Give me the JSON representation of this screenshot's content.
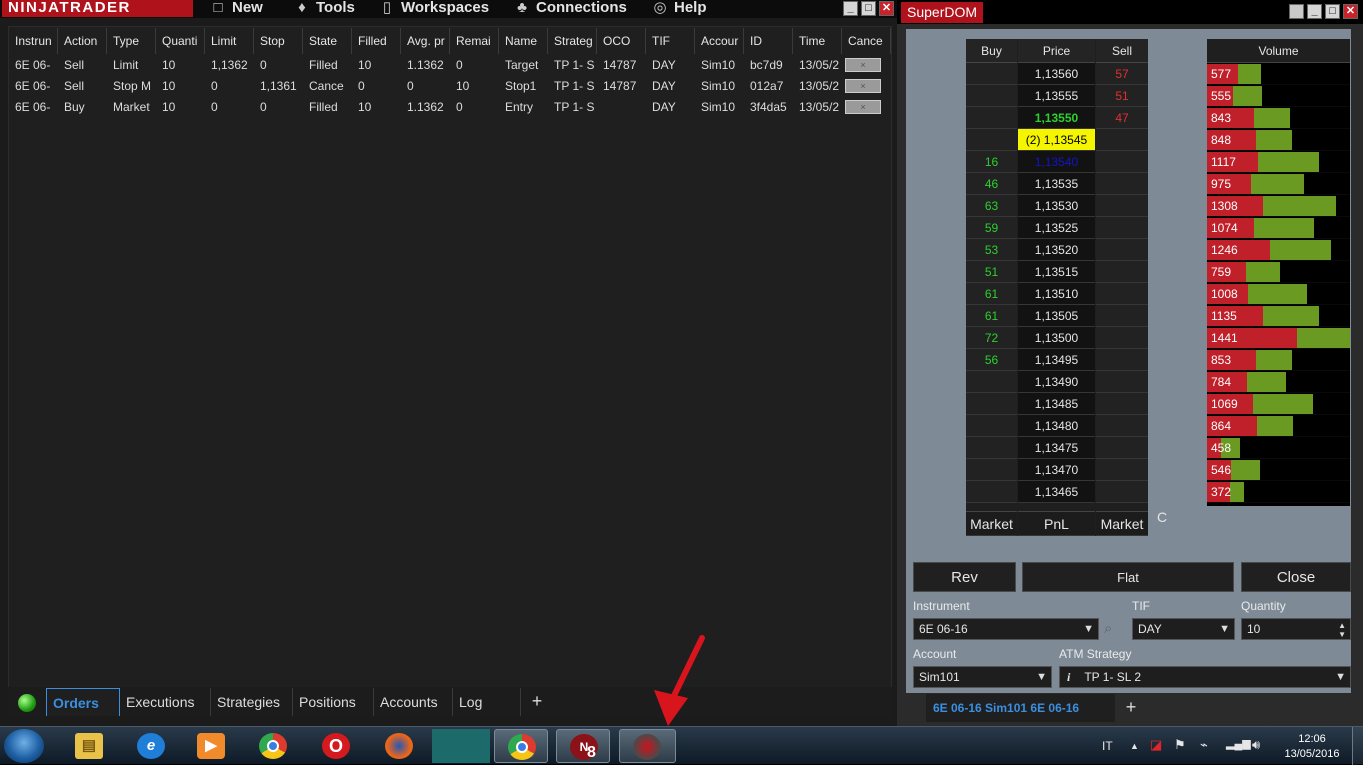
{
  "main": {
    "logo": "NINJATRADER",
    "menu": [
      {
        "icon": "new-window-icon",
        "glyph": "□",
        "label": "New"
      },
      {
        "icon": "wrench-icon",
        "glyph": "♦",
        "label": "Tools"
      },
      {
        "icon": "document-icon",
        "glyph": "▯",
        "label": "Workspaces"
      },
      {
        "icon": "plug-icon",
        "glyph": "♣",
        "label": "Connections"
      },
      {
        "icon": "lifebuoy-icon",
        "glyph": "◎",
        "label": "Help"
      }
    ]
  },
  "orders": {
    "columns": [
      "Instrun",
      "Action",
      "Type",
      "Quanti",
      "Limit",
      "Stop",
      "State",
      "Filled",
      "Avg. pr",
      "Remai",
      "Name",
      "Strateg",
      "OCO",
      "TIF",
      "Accour",
      "ID",
      "Time",
      "Cance"
    ],
    "rows": [
      [
        "6E 06-",
        "Sell",
        "Limit",
        "10",
        "1,1362",
        "0",
        "Filled",
        "10",
        "1.1362",
        "0",
        "Target",
        "TP 1- S",
        "14787",
        "DAY",
        "Sim10",
        "bc7d9",
        "13/05/2",
        "×"
      ],
      [
        "6E 06-",
        "Sell",
        "Stop M",
        "10",
        "0",
        "1,1361",
        "Cance",
        "0",
        "0",
        "10",
        "Stop1",
        "TP 1- S",
        "14787",
        "DAY",
        "Sim10",
        "012a7",
        "13/05/2",
        "×"
      ],
      [
        "6E 06-",
        "Buy",
        "Market",
        "10",
        "0",
        "0",
        "Filled",
        "10",
        "1.1362",
        "0",
        "Entry",
        "TP 1- S",
        "",
        "DAY",
        "Sim10",
        "3f4da5",
        "13/05/2",
        "×"
      ]
    ]
  },
  "bottom_tabs": [
    "Orders",
    "Executions",
    "Strategies",
    "Positions",
    "Accounts",
    "Log"
  ],
  "add_tab": "+",
  "superdom": {
    "title": "SuperDOM",
    "headers": {
      "buy": "Buy",
      "price": "Price",
      "sell": "Sell",
      "volume": "Volume"
    },
    "ladder": [
      {
        "buy": "",
        "price": "1,13560",
        "sell": "57"
      },
      {
        "buy": "",
        "price": "1,13555",
        "sell": "51"
      },
      {
        "buy": "",
        "price": "1,13550",
        "sell": "47",
        "style": "best-ask"
      },
      {
        "buy": "",
        "price": "(2) 1,13545",
        "sell": "",
        "style": "last"
      },
      {
        "buy": "16",
        "price": "1,13540",
        "sell": "",
        "style": "best-bid"
      },
      {
        "buy": "46",
        "price": "1,13535",
        "sell": ""
      },
      {
        "buy": "63",
        "price": "1,13530",
        "sell": ""
      },
      {
        "buy": "59",
        "price": "1,13525",
        "sell": ""
      },
      {
        "buy": "53",
        "price": "1,13520",
        "sell": ""
      },
      {
        "buy": "51",
        "price": "1,13515",
        "sell": ""
      },
      {
        "buy": "61",
        "price": "1,13510",
        "sell": ""
      },
      {
        "buy": "61",
        "price": "1,13505",
        "sell": ""
      },
      {
        "buy": "72",
        "price": "1,13500",
        "sell": ""
      },
      {
        "buy": "56",
        "price": "1,13495",
        "sell": ""
      },
      {
        "buy": "",
        "price": "1,13490",
        "sell": ""
      },
      {
        "buy": "",
        "price": "1,13485",
        "sell": ""
      },
      {
        "buy": "",
        "price": "1,13480",
        "sell": ""
      },
      {
        "buy": "",
        "price": "1,13475",
        "sell": ""
      },
      {
        "buy": "",
        "price": "1,13470",
        "sell": ""
      },
      {
        "buy": "",
        "price": "1,13465",
        "sell": ""
      }
    ],
    "volume": [
      {
        "label": "577",
        "red": 0.22,
        "green": 0.16
      },
      {
        "label": "555",
        "red": 0.18,
        "green": 0.2
      },
      {
        "label": "843",
        "red": 0.33,
        "green": 0.25
      },
      {
        "label": "848",
        "red": 0.34,
        "green": 0.25
      },
      {
        "label": "1117",
        "red": 0.36,
        "green": 0.43
      },
      {
        "label": "975",
        "red": 0.31,
        "green": 0.37
      },
      {
        "label": "1308",
        "red": 0.39,
        "green": 0.51
      },
      {
        "label": "1074",
        "red": 0.33,
        "green": 0.42
      },
      {
        "label": "1246",
        "red": 0.44,
        "green": 0.43
      },
      {
        "label": "759",
        "red": 0.27,
        "green": 0.24
      },
      {
        "label": "1008",
        "red": 0.29,
        "green": 0.41
      },
      {
        "label": "1135",
        "red": 0.39,
        "green": 0.39
      },
      {
        "label": "1441",
        "red": 0.63,
        "green": 0.37
      },
      {
        "label": "853",
        "red": 0.34,
        "green": 0.25
      },
      {
        "label": "784",
        "red": 0.28,
        "green": 0.27
      },
      {
        "label": "1069",
        "red": 0.32,
        "green": 0.42
      },
      {
        "label": "864",
        "red": 0.35,
        "green": 0.25
      },
      {
        "label": "458",
        "red": 0.1,
        "green": 0.13
      },
      {
        "label": "546",
        "red": 0.17,
        "green": 0.2
      },
      {
        "label": "372",
        "red": 0.16,
        "green": 0.1
      }
    ],
    "footer": {
      "buy": "Market",
      "price": "PnL",
      "sell": "Market"
    },
    "c_label": "C",
    "buttons": {
      "rev": "Rev",
      "flat": "Flat",
      "close": "Close"
    },
    "labels": {
      "instrument": "Instrument",
      "tif": "TIF",
      "quantity": "Quantity",
      "account": "Account",
      "atm": "ATM Strategy"
    },
    "values": {
      "instrument": "6E 06-16",
      "tif": "DAY",
      "quantity": "10",
      "account": "Sim101",
      "atm": "TP 1- SL  2",
      "info": "i"
    },
    "tab": "6E 06-16  Sim101  6E 06-16",
    "add_tab": "+"
  },
  "taskbar": {
    "language": "IT",
    "time": "12:06",
    "date": "13/05/2016",
    "badge": "8"
  },
  "colors": {
    "brand": "#b0121c",
    "tab_accent": "#3b8fe0",
    "buy_text": "#2ed02e",
    "sell_text": "#e03030",
    "last_price_bg": "#f5f500",
    "vol_red": "#c0202a",
    "vol_green": "#6b9a22"
  }
}
